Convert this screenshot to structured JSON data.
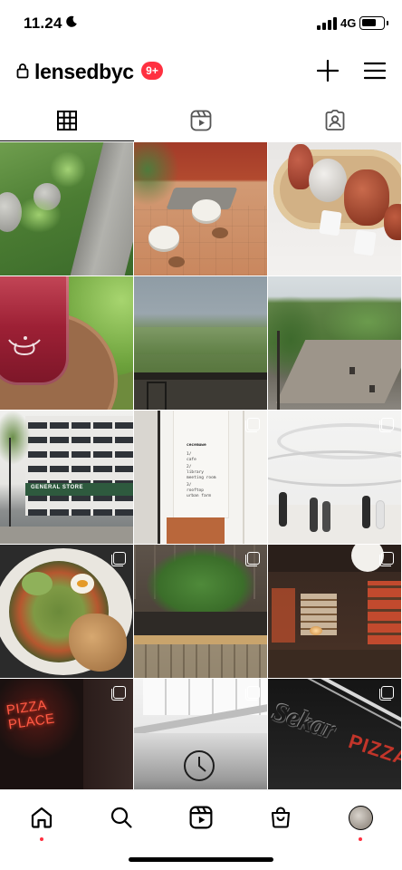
{
  "status_bar": {
    "time": "11.24",
    "network": "4G",
    "battery_level": 0.72
  },
  "header": {
    "username": "lensedbyc",
    "notification_badge": "9+"
  },
  "tabs": [
    {
      "name": "grid-tab",
      "icon": "grid-icon",
      "active": true
    },
    {
      "name": "reels-tab",
      "icon": "reels-icon",
      "active": false
    },
    {
      "name": "tagged-tab",
      "icon": "tagged-icon",
      "active": false
    }
  ],
  "posts": [
    {
      "subject": "grass and stones",
      "multi": false
    },
    {
      "subject": "cafe terrace tables",
      "multi": false
    },
    {
      "subject": "ceramic vases on tray",
      "multi": false
    },
    {
      "subject": "red drink in cup",
      "multi": false
    },
    {
      "subject": "green hills view",
      "multi": false
    },
    {
      "subject": "garden terrace",
      "multi": false
    },
    {
      "subject": "building courtyard",
      "multi": false
    },
    {
      "subject": "white wall signage",
      "multi": true
    },
    {
      "subject": "white atrium",
      "multi": true
    },
    {
      "subject": "salad bowl",
      "multi": true
    },
    {
      "subject": "indoor trees",
      "multi": true
    },
    {
      "subject": "dark cafe interior",
      "multi": true
    },
    {
      "subject": "pizza place neon",
      "multi": true
    },
    {
      "subject": "skylight clock",
      "multi": true
    },
    {
      "subject": "sekar pizza sign",
      "multi": true
    }
  ],
  "photo_text": {
    "signage_brand": "cecemuwe",
    "signage_items": [
      "1/",
      "cafe",
      "2/",
      "library",
      "meeting room",
      "3/",
      "rooftop",
      "urban farm"
    ],
    "storefront": "GENERAL STORE",
    "neon_line1": "PIZZA",
    "neon_line2": "PLACE",
    "sekar": "Sekar",
    "pizza": "PIZZA"
  },
  "bottom_nav": [
    {
      "name": "home",
      "icon": "home-icon",
      "dot": true
    },
    {
      "name": "search",
      "icon": "search-icon",
      "dot": false
    },
    {
      "name": "reels",
      "icon": "reels-icon",
      "dot": false
    },
    {
      "name": "shop",
      "icon": "shop-icon",
      "dot": false
    },
    {
      "name": "profile",
      "icon": "avatar",
      "dot": true
    }
  ],
  "colors": {
    "accent_red": "#ff3040",
    "text": "#000000",
    "background": "#ffffff"
  }
}
